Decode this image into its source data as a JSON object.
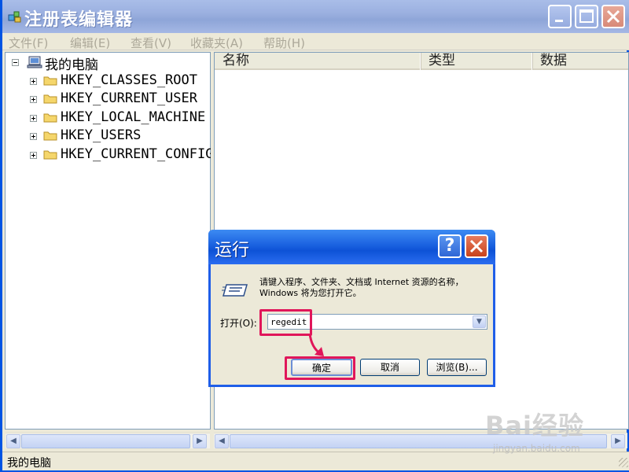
{
  "window": {
    "title": "注册表编辑器"
  },
  "menu": [
    {
      "label": "文件(F)"
    },
    {
      "label": "编辑(E)"
    },
    {
      "label": "查看(V)"
    },
    {
      "label": "收藏夹(A)"
    },
    {
      "label": "帮助(H)"
    }
  ],
  "tree": {
    "root": "我的电脑",
    "keys": [
      "HKEY_CLASSES_ROOT",
      "HKEY_CURRENT_USER",
      "HKEY_LOCAL_MACHINE",
      "HKEY_USERS",
      "HKEY_CURRENT_CONFIG"
    ]
  },
  "list": {
    "columns": [
      "名称",
      "类型",
      "数据"
    ]
  },
  "status": {
    "text": "我的电脑"
  },
  "dialog": {
    "title": "运行",
    "help": "?",
    "description": "请键入程序、文件夹、文档或 Internet 资源的名称，Windows 将为您打开它。",
    "open_label": "打开(O):",
    "input_value": "regedit",
    "ok": "确定",
    "cancel": "取消",
    "browse": "浏览(B)..."
  },
  "watermark": {
    "brand": "Bai经验",
    "url": "jingyan.baidu.com"
  },
  "colors": {
    "highlight": "#e0165a",
    "xp_blue": "#0d52d6"
  }
}
